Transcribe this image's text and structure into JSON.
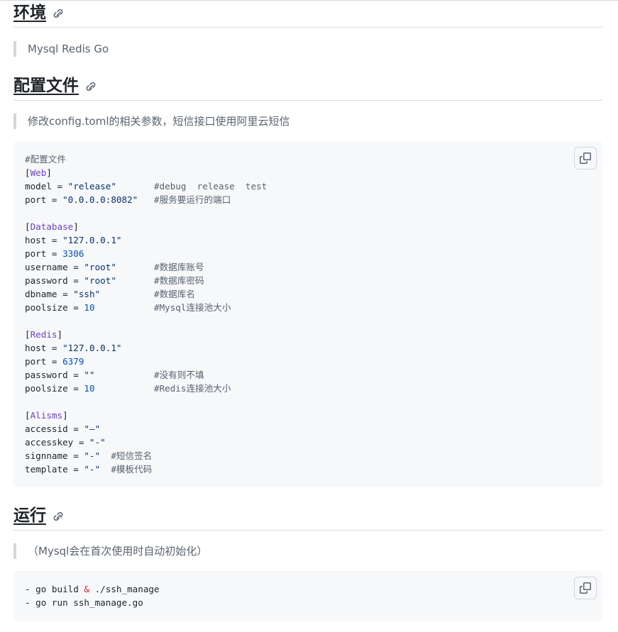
{
  "sections": {
    "env": {
      "title": "环境",
      "quote": "Mysql Redis Go"
    },
    "config": {
      "title": "配置文件",
      "quote": "修改config.toml的相关参数，短信接口使用阿里云短信"
    },
    "run": {
      "title": "运行",
      "quote": "（Mysql会在首次使用时自动初始化）"
    }
  },
  "config_code": [
    [
      {
        "t": "#配置文件",
        "c": "cm"
      }
    ],
    [
      {
        "t": "[",
        "c": ""
      },
      {
        "t": "Web",
        "c": "kw"
      },
      {
        "t": "]",
        "c": ""
      }
    ],
    [
      {
        "t": "model = ",
        "c": ""
      },
      {
        "t": "\"release\"",
        "c": "str"
      },
      {
        "t": "       #debug  release  test",
        "c": "cm"
      }
    ],
    [
      {
        "t": "port = ",
        "c": ""
      },
      {
        "t": "\"0.0.0.0:8082\"",
        "c": "str"
      },
      {
        "t": "   #服务要运行的端口",
        "c": "cm"
      }
    ],
    [],
    [
      {
        "t": "[",
        "c": ""
      },
      {
        "t": "Database",
        "c": "kw"
      },
      {
        "t": "]",
        "c": ""
      }
    ],
    [
      {
        "t": "host = ",
        "c": ""
      },
      {
        "t": "\"127.0.0.1\"",
        "c": "str"
      }
    ],
    [
      {
        "t": "port = ",
        "c": ""
      },
      {
        "t": "3306",
        "c": "num"
      }
    ],
    [
      {
        "t": "username = ",
        "c": ""
      },
      {
        "t": "\"root\"",
        "c": "str"
      },
      {
        "t": "       #数据库账号",
        "c": "cm"
      }
    ],
    [
      {
        "t": "password = ",
        "c": ""
      },
      {
        "t": "\"root\"",
        "c": "str"
      },
      {
        "t": "       #数据库密码",
        "c": "cm"
      }
    ],
    [
      {
        "t": "dbname = ",
        "c": ""
      },
      {
        "t": "\"ssh\"",
        "c": "str"
      },
      {
        "t": "          #数据库名",
        "c": "cm"
      }
    ],
    [
      {
        "t": "poolsize = ",
        "c": ""
      },
      {
        "t": "10",
        "c": "num"
      },
      {
        "t": "           #Mysql连接池大小",
        "c": "cm"
      }
    ],
    [],
    [
      {
        "t": "[",
        "c": ""
      },
      {
        "t": "Redis",
        "c": "kw"
      },
      {
        "t": "]",
        "c": ""
      }
    ],
    [
      {
        "t": "host = ",
        "c": ""
      },
      {
        "t": "\"127.0.0.1\"",
        "c": "str"
      }
    ],
    [
      {
        "t": "port = ",
        "c": ""
      },
      {
        "t": "6379",
        "c": "num"
      }
    ],
    [
      {
        "t": "password = ",
        "c": ""
      },
      {
        "t": "\"\"",
        "c": "str"
      },
      {
        "t": "           #没有则不填",
        "c": "cm"
      }
    ],
    [
      {
        "t": "poolsize = ",
        "c": ""
      },
      {
        "t": "10",
        "c": "num"
      },
      {
        "t": "           #Redis连接池大小",
        "c": "cm"
      }
    ],
    [],
    [
      {
        "t": "[",
        "c": ""
      },
      {
        "t": "Alisms",
        "c": "kw"
      },
      {
        "t": "]",
        "c": ""
      }
    ],
    [
      {
        "t": "accessid = ",
        "c": ""
      },
      {
        "t": "\"—\"",
        "c": "str"
      }
    ],
    [
      {
        "t": "accesskey = ",
        "c": ""
      },
      {
        "t": "\"-\"",
        "c": "str"
      }
    ],
    [
      {
        "t": "signname = ",
        "c": ""
      },
      {
        "t": "\"-\"",
        "c": "str"
      },
      {
        "t": "  #短信签名",
        "c": "cm"
      }
    ],
    [
      {
        "t": "template = ",
        "c": ""
      },
      {
        "t": "\"-\"",
        "c": "str"
      },
      {
        "t": "  #模板代码",
        "c": "cm"
      }
    ]
  ],
  "run_code": [
    [
      {
        "t": "- go build ",
        "c": ""
      },
      {
        "t": "&",
        "c": "op"
      },
      {
        "t": " ./ssh_manage",
        "c": ""
      }
    ],
    [
      {
        "t": "- go run ssh_manage.go",
        "c": ""
      }
    ]
  ],
  "icons": {
    "anchor": "link-icon",
    "copy": "copy-icon"
  },
  "colors": {
    "keyword": "#6f42c1",
    "string": "#0a3069",
    "number": "#0550ae",
    "comment": "#59636e",
    "operator": "#cf222e"
  }
}
